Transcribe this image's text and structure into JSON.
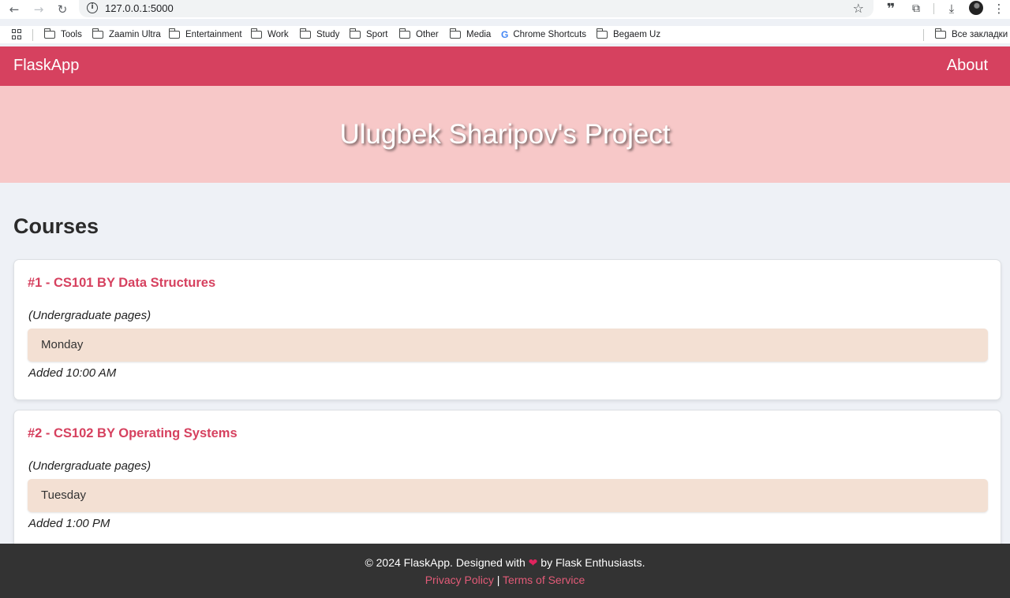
{
  "browser": {
    "url": "127.0.0.1:5000",
    "bookmarks": [
      "Tools",
      "Zaamin Ultra",
      "Entertainment",
      "Work",
      "Study",
      "Sport",
      "Other",
      "Media",
      "Chrome Shortcuts",
      "Begaem Uz"
    ],
    "all_bookmarks": "Все закладки"
  },
  "navbar": {
    "brand": "FlaskApp",
    "about": "About"
  },
  "hero": {
    "title": "Ulugbek Sharipov's Project"
  },
  "main": {
    "heading": "Courses",
    "courses": [
      {
        "title": "#1 - CS101 BY Data Structures",
        "pages": "(Undergraduate pages)",
        "day": "Monday",
        "added": "Added 10:00 AM"
      },
      {
        "title": "#2 - CS102 BY Operating Systems",
        "pages": "(Undergraduate pages)",
        "day": "Tuesday",
        "added": "Added 1:00 PM"
      }
    ]
  },
  "footer": {
    "copyright_before": "© 2024 FlaskApp. Designed with",
    "heart": "❤",
    "copyright_after": "by Flask Enthusiasts.",
    "privacy": "Privacy Policy",
    "separator": "|",
    "terms": "Terms of Service"
  },
  "colors": {
    "accent": "#d6415f",
    "hero_bg": "#f7c8c8",
    "day_bg": "#f3e0d3",
    "footer_bg": "#333333"
  }
}
